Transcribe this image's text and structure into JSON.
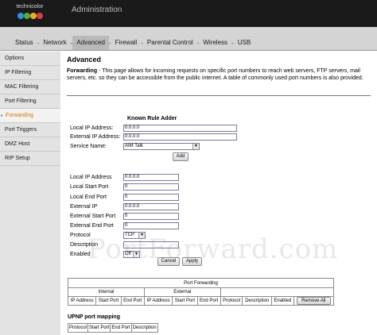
{
  "brand": {
    "logo_text": "technicolor",
    "app_title": "Administration"
  },
  "nav": {
    "items": [
      {
        "label": "Status",
        "active": false
      },
      {
        "label": "Network",
        "active": false
      },
      {
        "label": "Advanced",
        "active": true
      },
      {
        "label": "Firewall",
        "active": false
      },
      {
        "label": "Parental Control",
        "active": false
      },
      {
        "label": "Wireless",
        "active": false
      },
      {
        "label": "USB",
        "active": false
      }
    ],
    "separator": "-"
  },
  "sidebar": {
    "items": [
      {
        "label": "Options"
      },
      {
        "label": "IP Filtering"
      },
      {
        "label": "MAC Filtering"
      },
      {
        "label": "Port Filtering"
      },
      {
        "label": "Forwarding",
        "active": true
      },
      {
        "label": "Port Triggers"
      },
      {
        "label": "DMZ Host"
      },
      {
        "label": "RIP Setup"
      }
    ]
  },
  "page": {
    "title": "Advanced",
    "desc_bold": "Forwarding",
    "desc_rest": " - This page allows for incoming requests on specific port numbers to reach web servers, FTP servers, mail servers, etc. so they can be accessible from the public internet. A table of commonly used port numbers is also provided."
  },
  "known_rule": {
    "title": "Known Rule Adder",
    "local_ip_label": "Local IP Address:",
    "local_ip_value": "0.0.0.0",
    "external_ip_label": "External IP Address:",
    "external_ip_value": "0.0.0.0",
    "service_label": "Service Name:",
    "service_value": "AIM Talk",
    "add_label": "Add"
  },
  "rule_form": {
    "local_ip_label": "Local IP Address",
    "local_ip_value": "0.0.0.0",
    "local_start_label": "Local Start Port",
    "local_start_value": "0",
    "local_end_label": "Local End Port",
    "local_end_value": "0",
    "external_ip_label": "External IP",
    "external_ip_value": "0.0.0.0",
    "external_start_label": "External Start Port",
    "external_start_value": "0",
    "external_end_label": "External End Port",
    "external_end_value": "0",
    "protocol_label": "Protocol",
    "protocol_value": "TCP",
    "description_label": "Description",
    "description_value": "",
    "enabled_label": "Enabled",
    "enabled_value": "Off",
    "cancel_label": "Cancel",
    "apply_label": "Apply"
  },
  "port_forwarding_table": {
    "title": "Port Forwarding",
    "group_internal": "Internal",
    "group_external": "External",
    "columns": [
      "IP Address",
      "Start Port",
      "End Port",
      "IP Address",
      "Start Port",
      "End Port",
      "Protocol",
      "Description",
      "Enabled"
    ],
    "remove_all_label": "Remove All"
  },
  "upnp": {
    "title": "UPNP port mapping",
    "columns": [
      "Protocol",
      "Start Port",
      "End Port",
      "Description"
    ]
  },
  "watermark": "PortForward.com",
  "colors": {
    "header": "#1a1a1a",
    "navbar": "#d4d4d4",
    "sidebar": "#e3e3e3",
    "active_side": "#e07000"
  }
}
